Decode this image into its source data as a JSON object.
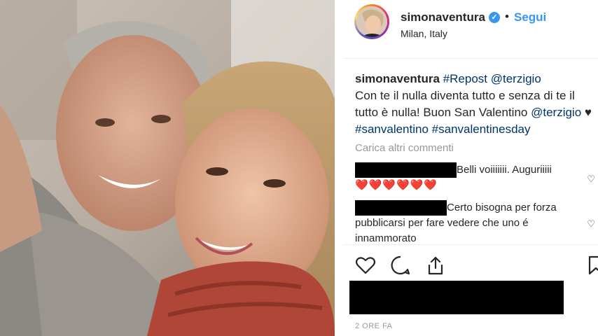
{
  "post": {
    "username": "simonaventura",
    "follow_label": "Segui",
    "separator": "•",
    "verified_mark": "✓",
    "location": "Milan, Italy"
  },
  "caption": {
    "user": "simonaventura",
    "hashtag_repost": "#Repost",
    "mention_1": "@terzigio",
    "text_1": "Con te il nulla diventa tutto e senza di te il tutto è nulla! Buon San Valentino",
    "mention_2": "@terzigio",
    "heart": "♥",
    "hashtag_1": "#sanvalentino",
    "hashtag_2": "#sanvalentinesday"
  },
  "comments": {
    "load_more": "Carica altri commenti",
    "items": [
      {
        "text": "Belli voiiiiiii. Auguriiiii",
        "emoji": "❤️❤️❤️❤️❤️❤️"
      },
      {
        "text": "Certo bisogna per forza pubblicarsi per fare vedere che uno é innammorato"
      }
    ],
    "like_icon": "♡"
  },
  "timestamp": "2 ORE FA",
  "icons": [
    "heart-icon",
    "comment-icon",
    "share-icon",
    "bookmark-icon",
    "verified-icon"
  ]
}
